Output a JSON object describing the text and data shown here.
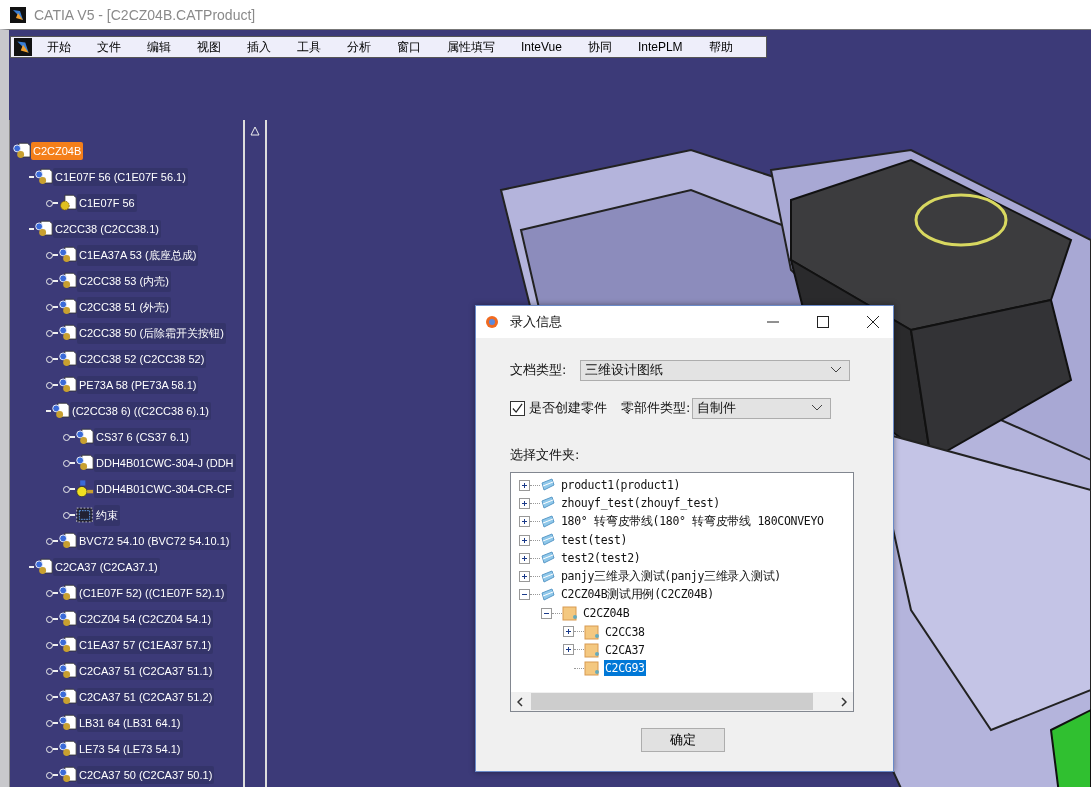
{
  "window": {
    "title": "CATIA V5 - [C2CZ04B.CATProduct]"
  },
  "menu": [
    "开始",
    "文件",
    "编辑",
    "视图",
    "插入",
    "工具",
    "分析",
    "窗口",
    "属性填写",
    "InteVue",
    "协同",
    "IntePLM",
    "帮助"
  ],
  "tree": [
    {
      "label": "C2CZ04B",
      "kind": "product",
      "selected": true,
      "children": [
        {
          "label": "C1E07F 56 (C1E07F 56.1)",
          "kind": "product",
          "selected": false,
          "expanded": true,
          "children": [
            {
              "label": "C1E07F 56",
              "kind": "gear",
              "selected": false
            }
          ]
        },
        {
          "label": "C2CC38 (C2CC38.1)",
          "kind": "product",
          "selected": false,
          "expanded": true,
          "children": [
            {
              "label": "C1EA37A 53 (底座总成)",
              "kind": "product",
              "selected": false
            },
            {
              "label": "C2CC38 53 (内壳)",
              "kind": "product",
              "selected": false
            },
            {
              "label": "C2CC38 51 (外壳)",
              "kind": "product",
              "selected": false
            },
            {
              "label": "C2CC38 50 (后除霜开关按钮)",
              "kind": "product",
              "selected": false
            },
            {
              "label": "C2CC38 52 (C2CC38 52)",
              "kind": "product",
              "selected": false
            },
            {
              "label": "PE73A 58 (PE73A 58.1)",
              "kind": "product",
              "selected": false
            },
            {
              "label": "(C2CC38 6) ((C2CC38 6).1)",
              "kind": "product",
              "selected": false,
              "expanded": true,
              "children": [
                {
                  "label": "CS37 6 (CS37 6.1)",
                  "kind": "product",
                  "selected": false
                },
                {
                  "label": "DDH4B01CWC-304-J (DDH",
                  "kind": "product",
                  "selected": false
                },
                {
                  "label": "DDH4B01CWC-304-CR-CF",
                  "kind": "key",
                  "selected": false
                },
                {
                  "label": "约束",
                  "kind": "constraints",
                  "selected": false
                }
              ]
            },
            {
              "label": "BVC72 54.10 (BVC72 54.10.1)",
              "kind": "product",
              "selected": false
            }
          ]
        },
        {
          "label": "C2CA37 (C2CA37.1)",
          "kind": "product",
          "selected": false,
          "expanded": true,
          "children": [
            {
              "label": "(C1E07F 52) ((C1E07F 52).1)",
              "kind": "product",
              "selected": false
            },
            {
              "label": "C2CZ04 54 (C2CZ04 54.1)",
              "kind": "product",
              "selected": false
            },
            {
              "label": "C1EA37 57 (C1EA37 57.1)",
              "kind": "product",
              "selected": false
            },
            {
              "label": "C2CA37 51 (C2CA37 51.1)",
              "kind": "product",
              "selected": false
            },
            {
              "label": "C2CA37 51 (C2CA37 51.2)",
              "kind": "product",
              "selected": false
            },
            {
              "label": "LB31 64 (LB31 64.1)",
              "kind": "product",
              "selected": false
            },
            {
              "label": "LE73 54 (LE73 54.1)",
              "kind": "product",
              "selected": false
            },
            {
              "label": "C2CA37 50 (C2CA37 50.1)",
              "kind": "product",
              "selected": false
            }
          ]
        }
      ]
    }
  ],
  "dialog": {
    "title": "录入信息",
    "doc_type": {
      "label": "文档类型:",
      "value": "三维设计图纸"
    },
    "create_part": {
      "label": "是否创建零件",
      "checked": true
    },
    "part_type": {
      "label": "零部件类型:",
      "value": "自制件"
    },
    "folder_label": "选择文件夹:",
    "folders": [
      {
        "label": "product1(product1)",
        "kind": "project",
        "expanded": false
      },
      {
        "label": "zhouyf_test(zhouyf_test)",
        "kind": "project",
        "expanded": false
      },
      {
        "label": "180° 转弯皮带线(180° 转弯皮带线 180CONVEYO",
        "kind": "project",
        "expanded": false
      },
      {
        "label": "test(test)",
        "kind": "project",
        "expanded": false
      },
      {
        "label": "test2(test2)",
        "kind": "project",
        "expanded": false
      },
      {
        "label": "panjy三维录入测试(panjy三维录入测试)",
        "kind": "project",
        "expanded": false
      },
      {
        "label": "C2CZ04B测试用例(C2CZ04B)",
        "kind": "project",
        "expanded": true,
        "selected": false,
        "children": [
          {
            "label": "C2CZ04B",
            "kind": "folder",
            "expanded": true,
            "selected": false,
            "children": [
              {
                "label": "C2CC38",
                "kind": "folder",
                "expanded": false,
                "selected": false
              },
              {
                "label": "C2CA37",
                "kind": "folder",
                "expanded": false,
                "selected": false
              },
              {
                "label": "C2CG93",
                "kind": "folder",
                "selected": true
              }
            ]
          }
        ]
      }
    ],
    "ok_button": "确定"
  }
}
